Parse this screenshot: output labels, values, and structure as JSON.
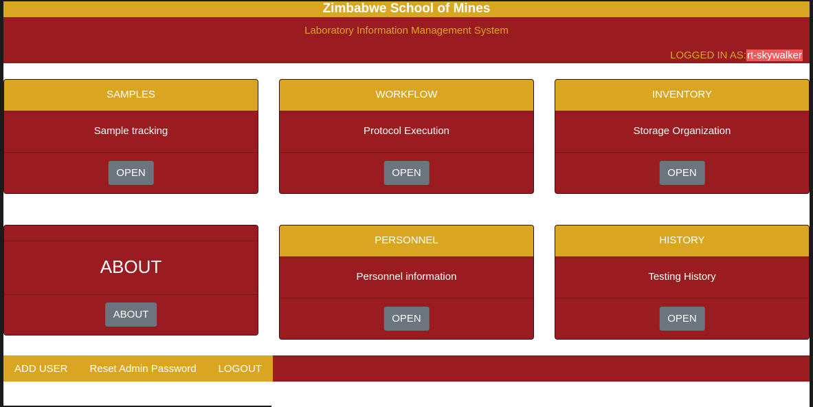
{
  "header": {
    "title": "Zimbabwe School of Mines",
    "subtitle": "Laboratory Information Management System",
    "logged_in_label": "LOGGED IN AS:",
    "username": "rt-skywalker"
  },
  "cards": {
    "samples": {
      "title": "SAMPLES",
      "description": "Sample tracking",
      "button": "OPEN"
    },
    "workflow": {
      "title": "WORKFLOW",
      "description": "Protocol Execution",
      "button": "OPEN"
    },
    "inventory": {
      "title": "INVENTORY",
      "description": "Storage Organization",
      "button": "OPEN"
    },
    "about": {
      "title": "ABOUT",
      "button": "ABOUT"
    },
    "personnel": {
      "title": "PERSONNEL",
      "description": "Personnel information",
      "button": "OPEN"
    },
    "history": {
      "title": "HISTORY",
      "description": "Testing History",
      "button": "OPEN"
    }
  },
  "footer": {
    "add_user": "ADD USER",
    "reset_admin_password": "Reset Admin Password",
    "logout": "LOGOUT"
  },
  "colors": {
    "gold": "#daa520",
    "crimson": "#9b1c20",
    "button_gray": "#6c757d",
    "username_highlight": "#f05a5a"
  }
}
